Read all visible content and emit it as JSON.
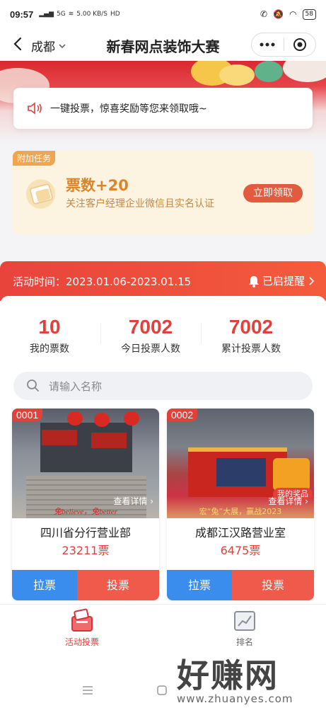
{
  "status_bar": {
    "time": "09:57",
    "network": "5G",
    "speed": "5.00 KB/S",
    "hd": "HD",
    "battery": "58"
  },
  "nav": {
    "city": "成都",
    "title": "新春网点装饰大赛"
  },
  "notice": {
    "text": "一键投票，惊喜奖励等您来领取哦~"
  },
  "task": {
    "tag": "附加任务",
    "title": "票数+20",
    "desc": "关注客户经理企业微信且实名认证",
    "button": "立即领取"
  },
  "activity": {
    "time": "活动时间：2023.01.06-2023.01.15",
    "remind": "已启提醒"
  },
  "stats": [
    {
      "value": "10",
      "label": "我的票数"
    },
    {
      "value": "7002",
      "label": "今日投票人数"
    },
    {
      "value": "7002",
      "label": "累计投票人数"
    }
  ],
  "search": {
    "placeholder": "请输入名称"
  },
  "cards": [
    {
      "no": "0001",
      "detail": "查看详情",
      "name": "四川省分行营业部",
      "votes": "23211票",
      "pull": "拉票",
      "vote": "投票",
      "caption": "兔believe，兔better"
    },
    {
      "no": "0002",
      "detail": "查看详情",
      "name": "成都江汉路营业室",
      "votes": "6475票",
      "pull": "拉票",
      "vote": "投票",
      "caption": "宏“兔”大展，赢战2023",
      "badge": "我的奖品"
    }
  ],
  "tabs": [
    {
      "label": "活动投票",
      "active": true
    },
    {
      "label": "排名",
      "active": false
    }
  ],
  "watermark": {
    "big": "好赚网",
    "small": "www.zhuanyes.com"
  },
  "colors": {
    "primary_red": "#e0413b",
    "blue": "#3a8ded",
    "orange": "#d9852c"
  }
}
